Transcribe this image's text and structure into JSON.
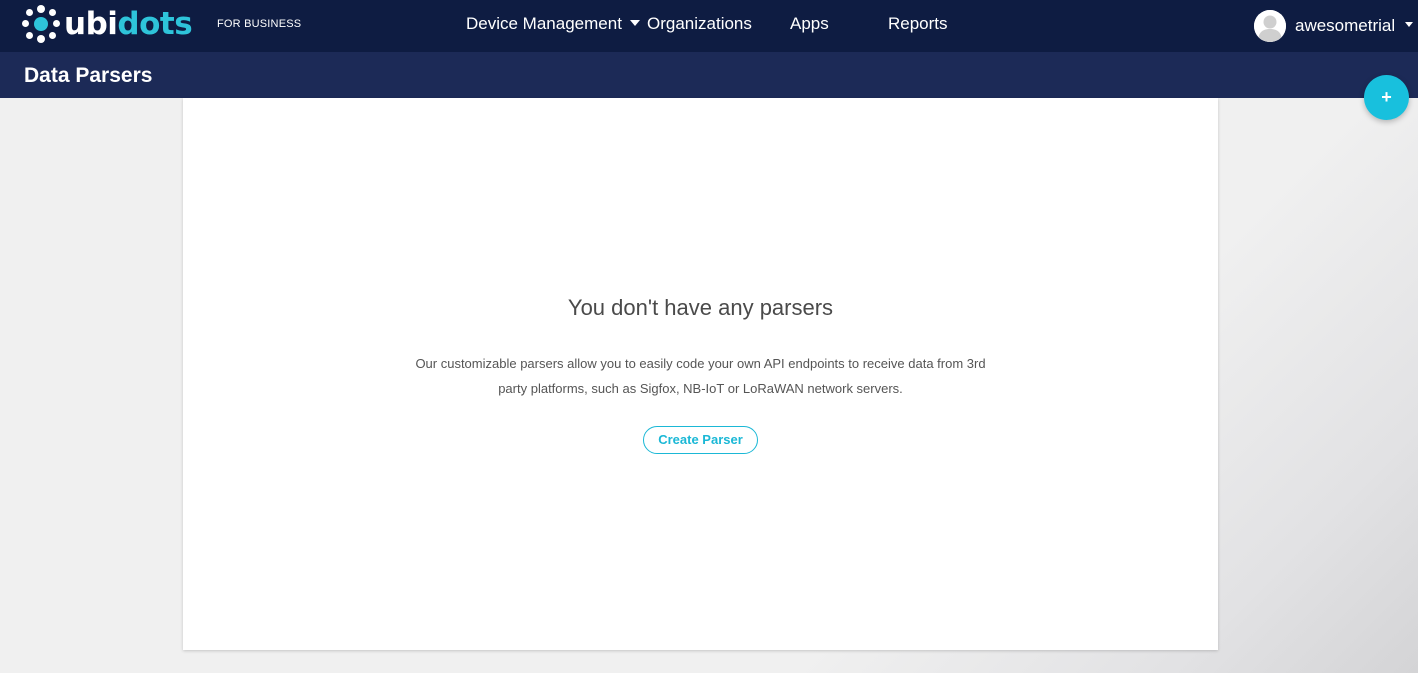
{
  "brand": {
    "logo_part1": "ubi",
    "logo_part2": "dots",
    "tagline": "FOR BUSINESS",
    "accent_color": "#2ec4da"
  },
  "nav": {
    "items": [
      {
        "label": "Device Management",
        "has_dropdown": true
      },
      {
        "label": "Organizations",
        "has_dropdown": false
      },
      {
        "label": "Apps",
        "has_dropdown": false
      },
      {
        "label": "Reports",
        "has_dropdown": false
      }
    ]
  },
  "user": {
    "name": "awesometrial",
    "avatar_icon": "user-avatar-icon"
  },
  "header": {
    "title": "Data Parsers",
    "add_button_label": "+"
  },
  "empty_state": {
    "title": "You don't have any parsers",
    "description": "Our customizable parsers allow you to easily code your own API endpoints to receive data from 3rd party platforms, such as Sigfox, NB-IoT or LoRaWAN network servers.",
    "button_label": "Create Parser"
  },
  "colors": {
    "topbar": "#0e1c42",
    "subbar": "#1c2a57",
    "fab": "#18c0dd",
    "button_border": "#1bb8d6"
  }
}
